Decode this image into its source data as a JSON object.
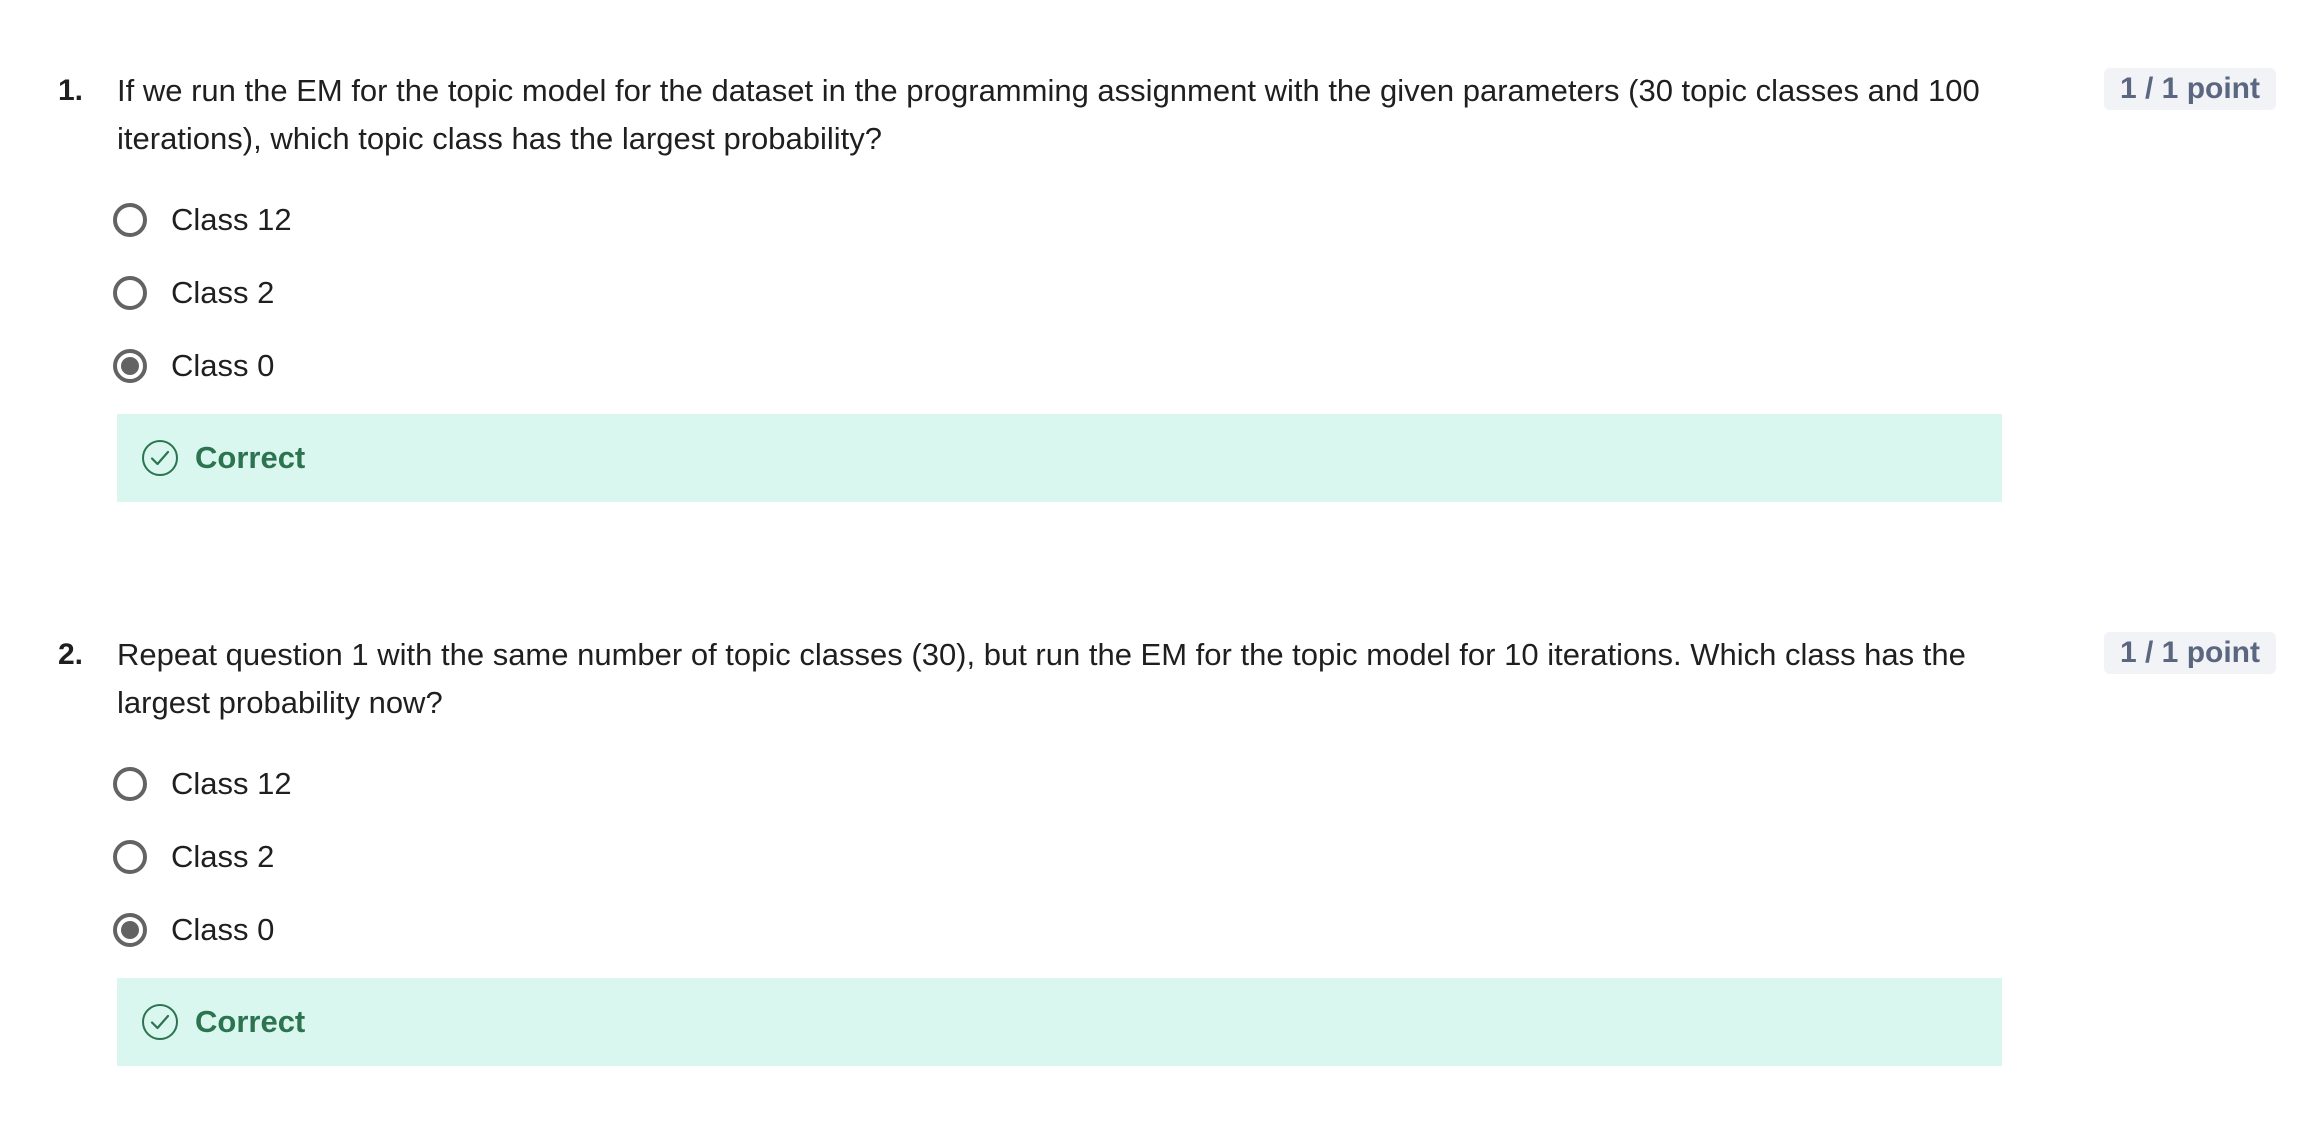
{
  "questions": [
    {
      "number": "1.",
      "text": "If we run the EM for the topic model for the dataset in the programming assignment with the given parameters (30 topic classes and 100 iterations), which topic class has the largest probability?",
      "points": "1 / 1 point",
      "options": [
        {
          "label": "Class 12",
          "selected": false
        },
        {
          "label": "Class 2",
          "selected": false
        },
        {
          "label": "Class 0",
          "selected": true
        }
      ],
      "feedback": "Correct"
    },
    {
      "number": "2.",
      "text": "Repeat question 1 with the same number of topic classes (30), but run the EM for the topic model for 10 iterations. Which class has the largest probability now?",
      "points": "1 / 1 point",
      "options": [
        {
          "label": "Class 12",
          "selected": false
        },
        {
          "label": "Class 2",
          "selected": false
        },
        {
          "label": "Class 0",
          "selected": true
        }
      ],
      "feedback": "Correct"
    }
  ],
  "colors": {
    "feedback_bg": "#d9f7ee",
    "feedback_text": "#2c7350",
    "points_bg": "#f1f3f7",
    "points_text": "#5b6780",
    "radio": "#636363"
  }
}
